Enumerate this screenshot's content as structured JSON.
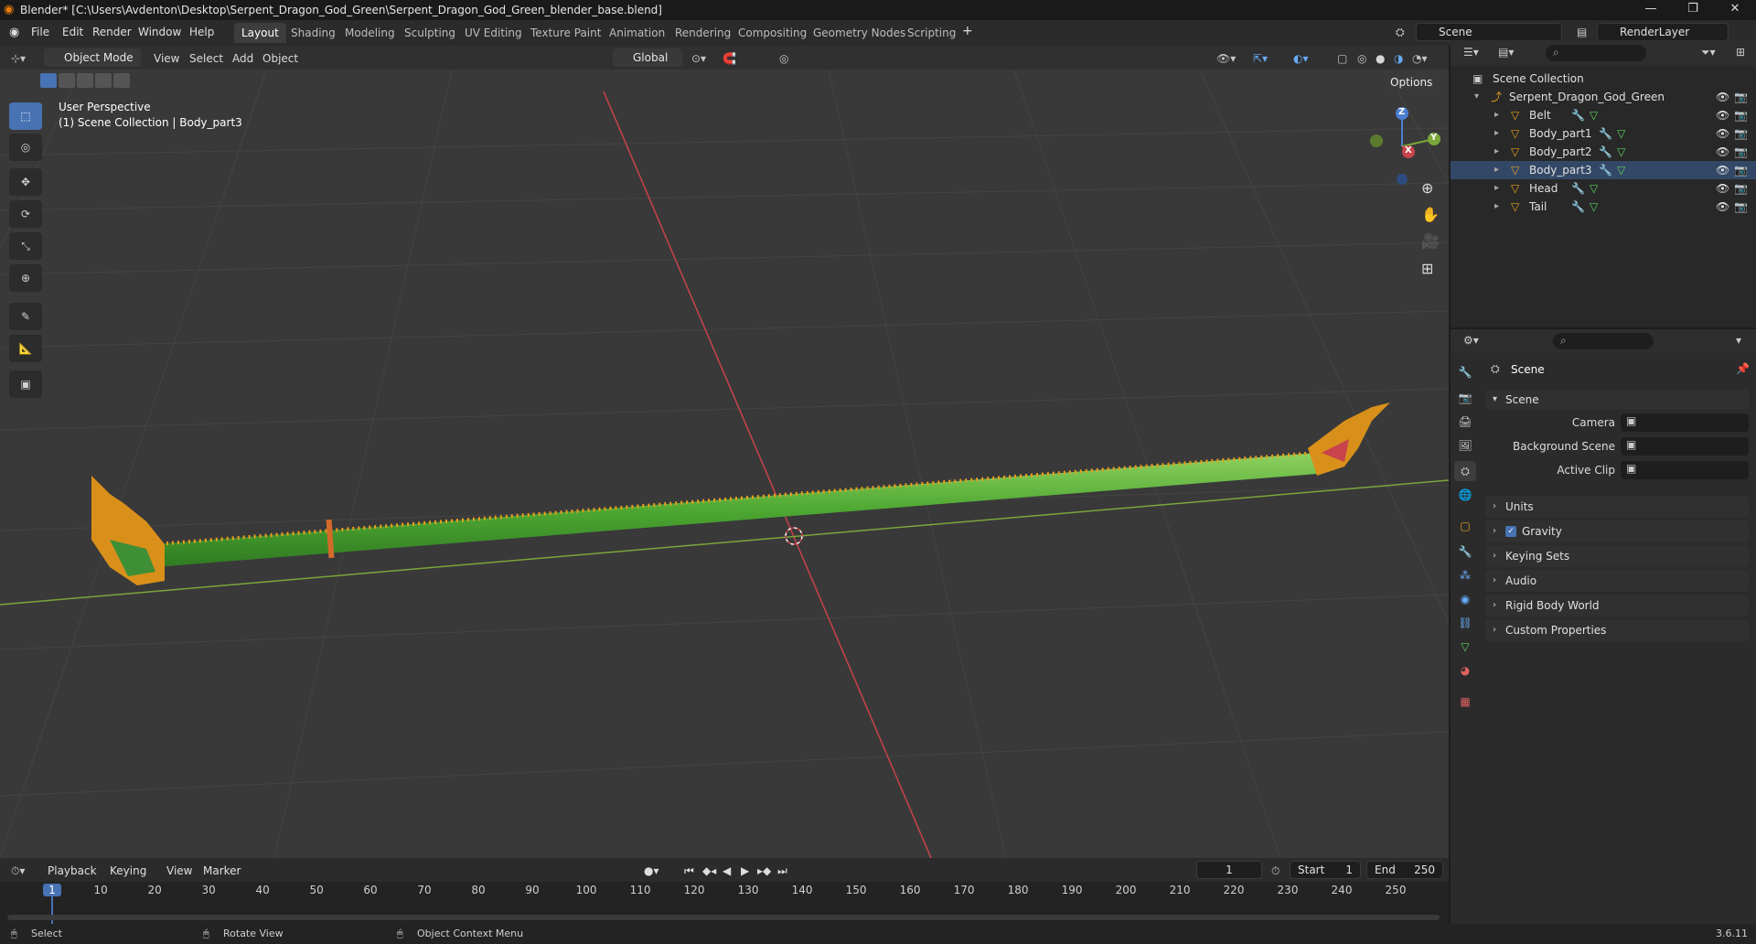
{
  "window": {
    "title": "Blender* [C:\\Users\\Avdenton\\Desktop\\Serpent_Dragon_God_Green\\Serpent_Dragon_God_Green_blender_base.blend]"
  },
  "menu": [
    "File",
    "Edit",
    "Render",
    "Window",
    "Help"
  ],
  "workspaces": [
    "Layout",
    "Shading",
    "Modeling",
    "Sculpting",
    "UV Editing",
    "Texture Paint",
    "Animation",
    "Rendering",
    "Compositing",
    "Geometry Nodes",
    "Scripting"
  ],
  "active_workspace": "Layout",
  "scene_field": "Scene",
  "renderlayer_field": "RenderLayer",
  "viewport": {
    "mode": "Object Mode",
    "menus": [
      "View",
      "Select",
      "Add",
      "Object"
    ],
    "orientation": "Global",
    "options_label": "Options",
    "overlay_line1": "User Perspective",
    "overlay_line2": "(1) Scene Collection | Body_part3",
    "gizmo": {
      "x": "X",
      "y": "Y",
      "z": "Z"
    }
  },
  "outliner": {
    "root": "Scene Collection",
    "collection": "Serpent_Dragon_God_Green",
    "objects": [
      "Belt",
      "Body_part1",
      "Body_part2",
      "Body_part3",
      "Head",
      "Tail"
    ]
  },
  "properties": {
    "header": "Scene",
    "panel_scene": "Scene",
    "fields": [
      {
        "label": "Camera",
        "value": ""
      },
      {
        "label": "Background Scene",
        "value": ""
      },
      {
        "label": "Active Clip",
        "value": ""
      }
    ],
    "panels": [
      "Units",
      "Gravity",
      "Keying Sets",
      "Audio",
      "Rigid Body World",
      "Custom Properties"
    ]
  },
  "timeline": {
    "menus": [
      "Playback",
      "Keying",
      "View",
      "Marker"
    ],
    "current_frame": "1",
    "start_label": "Start",
    "start": "1",
    "end_label": "End",
    "end": "250",
    "ticks": [
      "1",
      "10",
      "20",
      "30",
      "40",
      "50",
      "60",
      "70",
      "80",
      "90",
      "100",
      "110",
      "120",
      "130",
      "140",
      "150",
      "160",
      "170",
      "180",
      "190",
      "200",
      "210",
      "220",
      "230",
      "240",
      "250"
    ]
  },
  "status": {
    "select": "Select",
    "rotate": "Rotate View",
    "context": "Object Context Menu",
    "version": "3.6.11"
  },
  "colors": {
    "accent": "#4772b3",
    "x_axis": "#c8434b",
    "y_axis": "#7aa63a",
    "serpent": "#5fb040",
    "gold": "#e8a020"
  }
}
